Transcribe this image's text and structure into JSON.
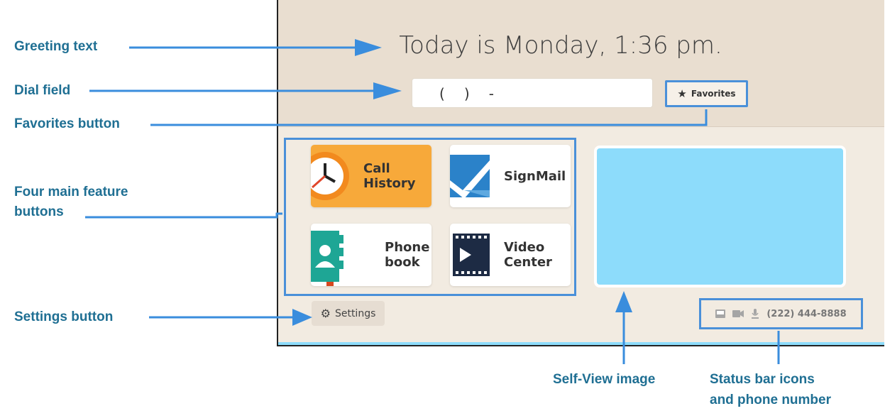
{
  "callouts": {
    "greeting_text": "Greeting text",
    "dial_field": "Dial field",
    "favorites_button": "Favorites button",
    "feature_buttons_line1": "Four main feature",
    "feature_buttons_line2": "buttons",
    "settings_button": "Settings button",
    "self_view": "Self-View image",
    "status_line1": "Status bar icons",
    "status_line2": "and phone number"
  },
  "screen": {
    "greeting": "Today is Monday, 1:36 pm.",
    "dial_value": "(   )   -",
    "favorites_label": "Favorites",
    "features": [
      {
        "line1": "Call",
        "line2": "History"
      },
      {
        "line1": "SignMail",
        "line2": ""
      },
      {
        "line1": "Phone",
        "line2": "book"
      },
      {
        "line1": "Video",
        "line2": "Center"
      }
    ],
    "settings_label": "Settings",
    "phone_number": "(222) 444-8888"
  },
  "colors": {
    "accent": "#4a90d9",
    "callout_text": "#1f6f93",
    "call_history_bg": "#f7a93a",
    "self_view_bg": "#8ddcfb"
  },
  "icons": [
    "star-icon",
    "clock-icon",
    "signmail-icon",
    "phonebook-icon",
    "video-center-icon",
    "gear-icon",
    "network-icon",
    "camera-icon",
    "microphone-icon"
  ]
}
